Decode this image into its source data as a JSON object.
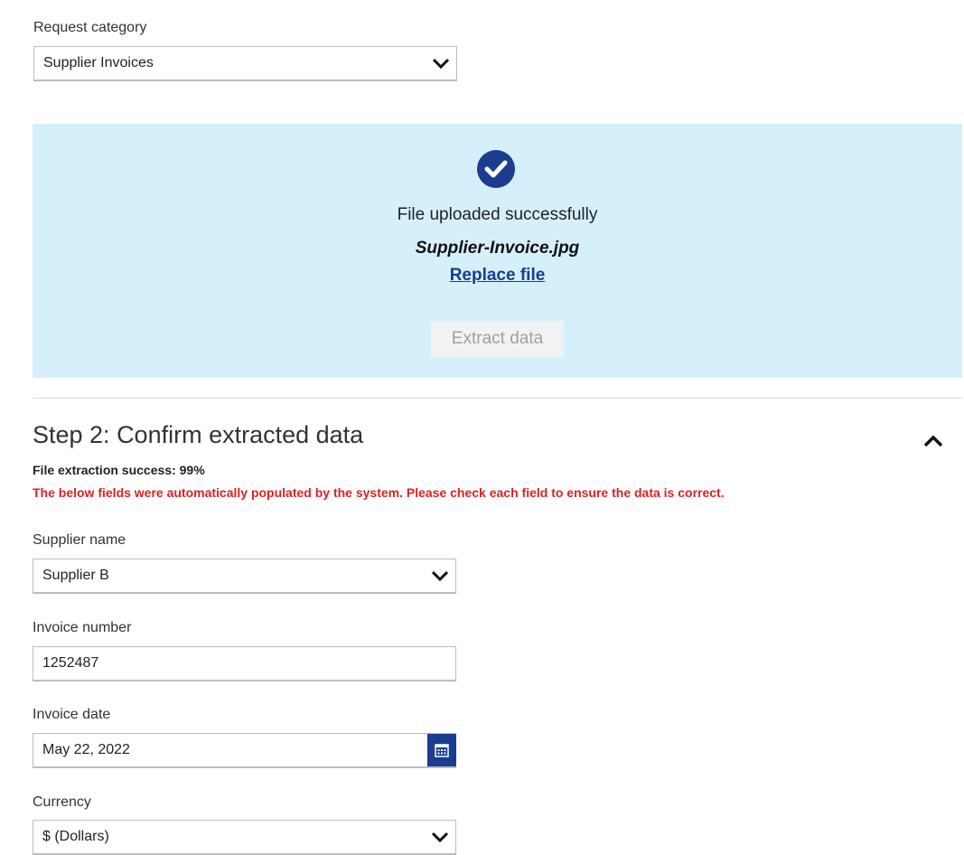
{
  "request_category": {
    "label": "Request category",
    "value": "Supplier Invoices"
  },
  "upload": {
    "status": "File uploaded successfully",
    "file_name": "Supplier-Invoice.jpg",
    "replace_label": "Replace file",
    "extract_label": "Extract data",
    "bg_color": "#d6f0fb",
    "icon": "check-circle-icon"
  },
  "step2": {
    "title": "Step 2: Confirm extracted data",
    "extraction_success": "File extraction success: 99%",
    "warning": "The below fields were automatically populated by the system. Please check each field to ensure the data is correct.",
    "warning_color": "#e0201f"
  },
  "fields": {
    "supplier_name": {
      "label": "Supplier name",
      "value": "Supplier B"
    },
    "invoice_number": {
      "label": "Invoice number",
      "value": "1252487"
    },
    "invoice_date": {
      "label": "Invoice date",
      "value": "May 22, 2022"
    },
    "currency": {
      "label": "Currency",
      "value": "$ (Dollars)"
    }
  },
  "colors": {
    "accent": "#1a3d8f"
  }
}
